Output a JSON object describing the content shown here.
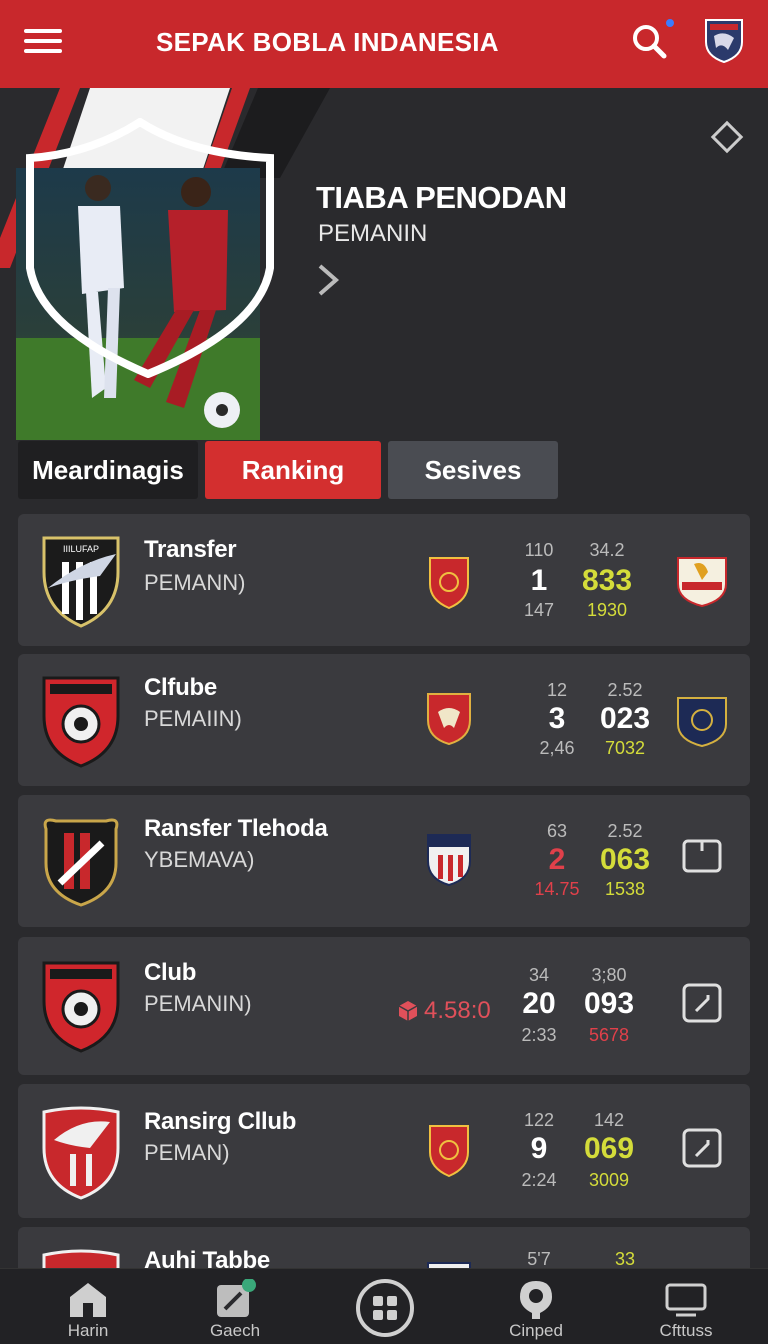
{
  "header": {
    "title": "SEPAK BOBLA INDANESIA",
    "menu_icon": "hamburger-icon",
    "search_icon": "search-icon",
    "notification_dot_color": "#3b7bff",
    "crest_icon": "club-crest-icon",
    "bar_color": "#c8282c"
  },
  "hero": {
    "title": "TIABA PENODAN",
    "subtitle": "PEMANIN",
    "chevron_icon": "chevron-right-icon",
    "diamond_icon": "diamond-icon"
  },
  "tabs": [
    {
      "label": "Meardinagis",
      "active": false
    },
    {
      "label": "Ranking",
      "active": true
    },
    {
      "label": "Sesives",
      "active": false
    }
  ],
  "rows": [
    {
      "name": "Transfer",
      "sub": "PEMANN)",
      "crest_text": "IIILUFAP",
      "left_top": "110",
      "left_mid": "1",
      "left_bot": "147",
      "right_top": "34.2",
      "right_mid": "833",
      "right_bot": "1930",
      "mid_color": "#ffffff",
      "right_color": "#d4dc3a",
      "right_bot_color": "#d4dc3a",
      "left_bot_color": "#bbbbbb",
      "right_icon": "club-crest-icon"
    },
    {
      "name": "Clfube",
      "sub": "PEMAIIN)",
      "crest_text": "",
      "left_top": "12",
      "left_mid": "3",
      "left_bot": "2,46",
      "right_top": "2.52",
      "right_mid": "023",
      "right_bot": "7032",
      "mid_color": "#ffffff",
      "right_color": "#ffffff",
      "right_bot_color": "#d4dc3a",
      "left_bot_color": "#bbbbbb",
      "right_icon": "club-crest-icon"
    },
    {
      "name": "Ransfer Tlehoda",
      "sub": "YBEMAVA)",
      "crest_text": "",
      "left_top": "63",
      "left_mid": "2",
      "left_bot": "14.75",
      "right_top": "2.52",
      "right_mid": "063",
      "right_bot": "1538",
      "mid_color": "#e0404a",
      "right_color": "#d4dc3a",
      "right_bot_color": "#d4dc3a",
      "left_bot_color": "#e0404a",
      "right_icon": "tablet-icon"
    },
    {
      "name": "Club",
      "sub": "PEMANIN)",
      "crest_text": "",
      "odds": "4.58:0",
      "left_top": "34",
      "left_mid": "20",
      "left_bot": "2:33",
      "right_top": "3;80",
      "right_mid": "093",
      "right_bot": "5678",
      "mid_color": "#ffffff",
      "right_color": "#ffffff",
      "right_bot_color": "#e0404a",
      "left_bot_color": "#bbbbbb",
      "right_icon": "share-box-icon"
    },
    {
      "name": "Ransirg Cllub",
      "sub": "PEMAN)",
      "crest_text": "",
      "left_top": "122",
      "left_mid": "9",
      "left_bot": "2:24",
      "right_top": "142",
      "right_mid": "069",
      "right_bot": "3009",
      "mid_color": "#ffffff",
      "right_color": "#d4dc3a",
      "right_bot_color": "#d4dc3a",
      "left_bot_color": "#bbbbbb",
      "right_icon": "share-box-icon"
    },
    {
      "name": "Auhi Tabbe",
      "left_top": "5'7",
      "right_top": "33"
    }
  ],
  "bottom_nav": [
    {
      "label": "Harin",
      "icon": "home-icon"
    },
    {
      "label": "Gaech",
      "icon": "edit-icon"
    },
    {
      "label": "",
      "icon": "grid-icon"
    },
    {
      "label": "Cinped",
      "icon": "pin-icon"
    },
    {
      "label": "Cfttuss",
      "icon": "monitor-icon"
    }
  ]
}
